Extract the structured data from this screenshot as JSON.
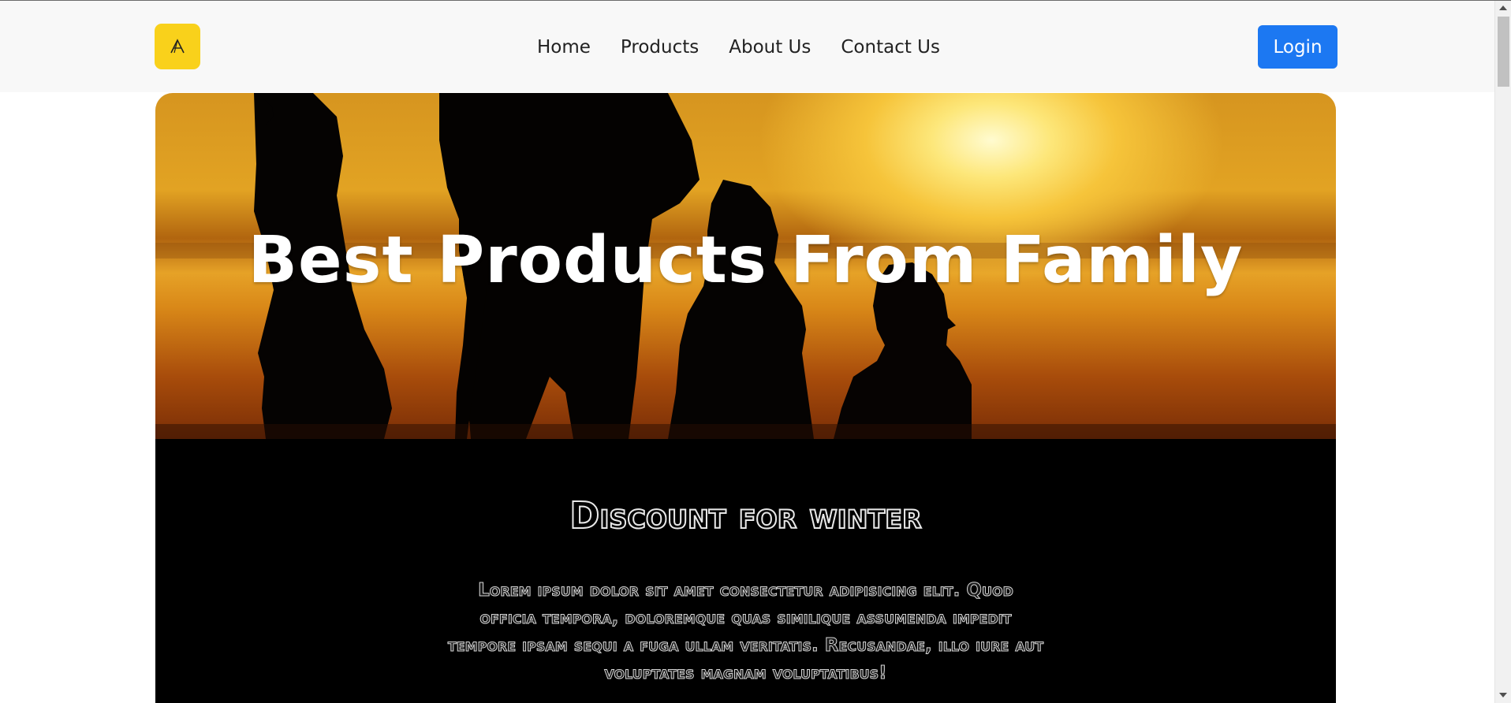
{
  "navbar": {
    "logo_icon": "a-letter-logo-icon",
    "links": [
      {
        "label": "Home"
      },
      {
        "label": "Products"
      },
      {
        "label": "About Us"
      },
      {
        "label": "Contact Us"
      }
    ],
    "login_label": "Login"
  },
  "hero": {
    "title": "Best Products From Family",
    "image": "family-silhouette-sunset"
  },
  "promo": {
    "title": "Discount for winter",
    "body": "Lorem ipsum dolor sit amet consectetur adipisicing elit. Quod officia tempora, doloremque quas similique assumenda impedit tempore ipsam sequi a fuga ullam veritatis. Recusandae, illo iure aut voluptates magnam voluptatibus!"
  },
  "colors": {
    "logo_bg": "#f9d11b",
    "login_bg": "#1c78f2",
    "navbar_bg": "#f8f8f8",
    "promo_bg": "#000000"
  }
}
